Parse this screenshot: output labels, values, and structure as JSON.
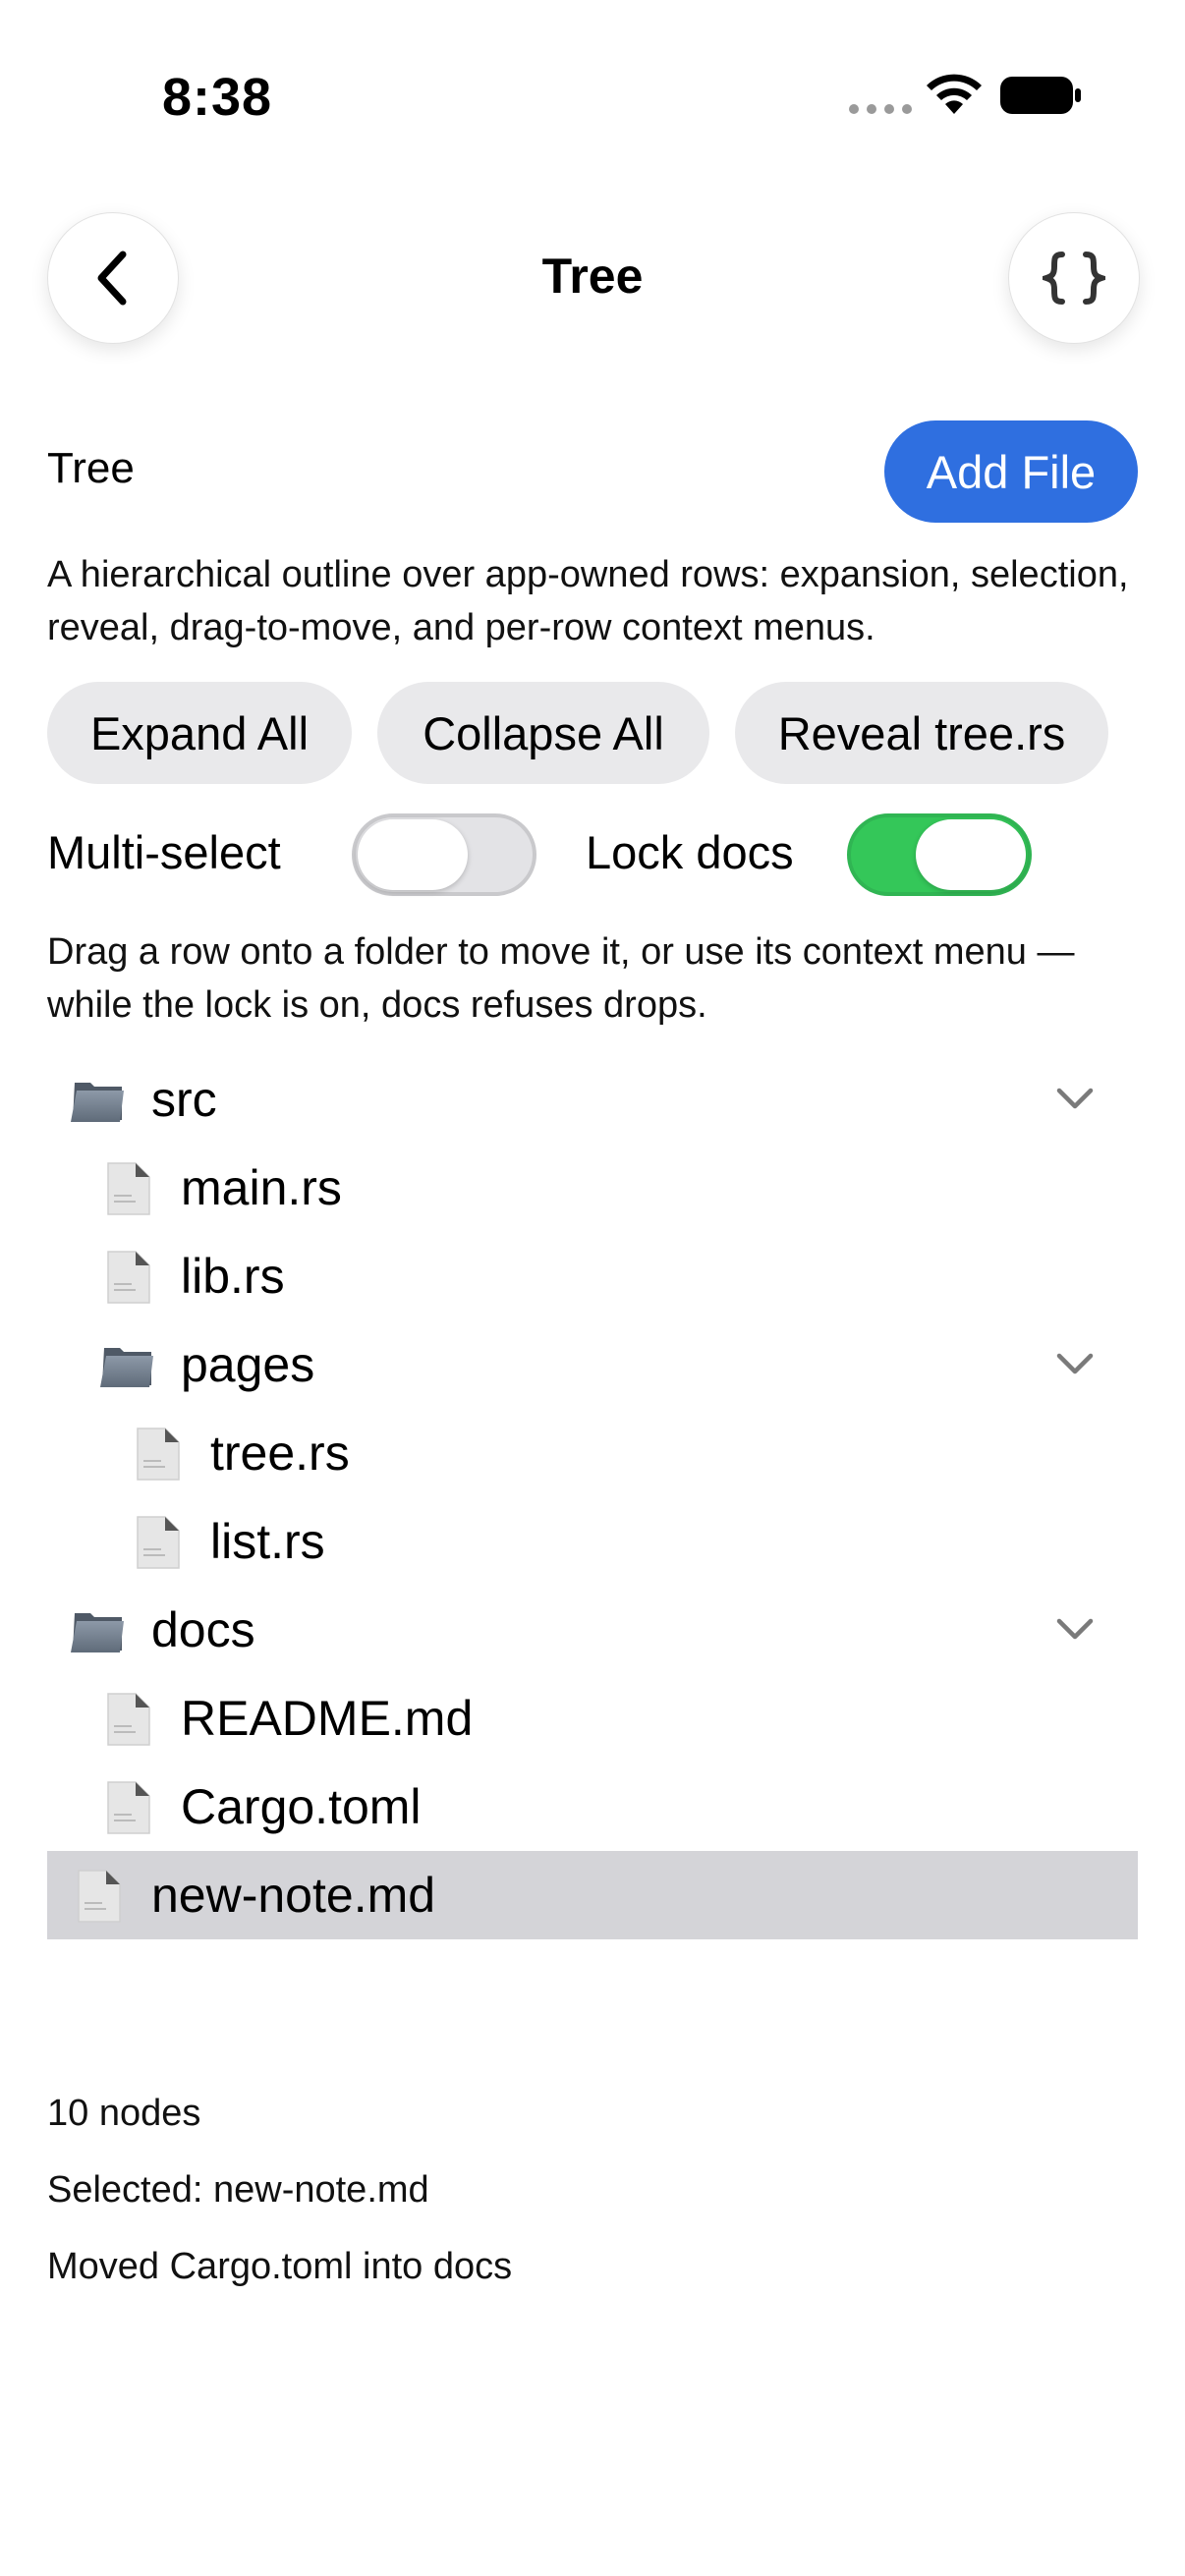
{
  "status_bar": {
    "time": "8:38"
  },
  "nav": {
    "title": "Tree",
    "back_icon": "chevron-left-icon",
    "code_icon": "braces-icon"
  },
  "section": {
    "title": "Tree",
    "add_file_label": "Add File",
    "description": "A hierarchical outline over app-owned rows: expansion, selection, reveal, drag-to-move, and per-row context menus."
  },
  "actions": {
    "expand_all": "Expand All",
    "collapse_all": "Collapse All",
    "reveal": "Reveal tree.rs"
  },
  "toggles": {
    "multi_select_label": "Multi-select",
    "multi_select_on": false,
    "lock_docs_label": "Lock docs",
    "lock_docs_on": true
  },
  "hint": "Drag a row onto a folder to move it, or use its context menu — while the lock is on, docs refuses drops.",
  "tree": {
    "rows": [
      {
        "label": "src",
        "kind": "folder",
        "depth": 0,
        "expanded": true
      },
      {
        "label": "main.rs",
        "kind": "file",
        "depth": 1
      },
      {
        "label": "lib.rs",
        "kind": "file",
        "depth": 1
      },
      {
        "label": "pages",
        "kind": "folder",
        "depth": 1,
        "expanded": true
      },
      {
        "label": "tree.rs",
        "kind": "file",
        "depth": 2
      },
      {
        "label": "list.rs",
        "kind": "file",
        "depth": 2
      },
      {
        "label": "docs",
        "kind": "folder",
        "depth": 0,
        "expanded": true
      },
      {
        "label": "README.md",
        "kind": "file",
        "depth": 1
      },
      {
        "label": "Cargo.toml",
        "kind": "file",
        "depth": 1
      },
      {
        "label": "new-note.md",
        "kind": "file",
        "depth": 0,
        "selected": true
      }
    ]
  },
  "footer": {
    "node_count": "10 nodes",
    "selected": "Selected: new-note.md",
    "last_action": "Moved Cargo.toml into docs"
  },
  "colors": {
    "accent": "#2f6fe0",
    "toggle_on": "#34c759",
    "selection": "#d4d4d8",
    "pill": "#e9e9eb"
  }
}
